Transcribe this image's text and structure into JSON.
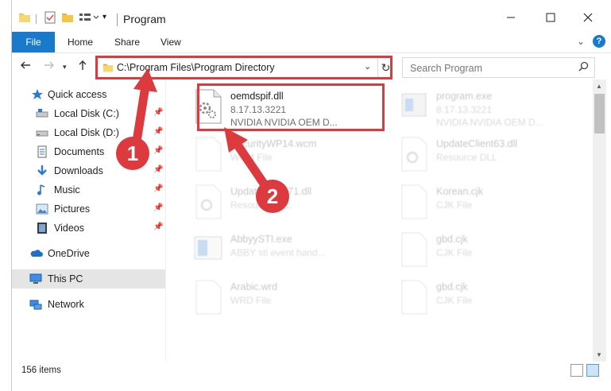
{
  "window": {
    "title": "Program",
    "controls": [
      "minimize",
      "maximize",
      "close"
    ]
  },
  "ribbon": {
    "file_label": "File",
    "tabs": [
      "Home",
      "Share",
      "View"
    ]
  },
  "address": {
    "path": "C:\\Program Files\\Program Directory",
    "search_placeholder": "Search Program"
  },
  "nav": {
    "items": [
      {
        "label": "Quick access",
        "icon": "star-icon",
        "pinned": false
      },
      {
        "label": "Local Disk (C:)",
        "icon": "drive-icon",
        "pinned": true
      },
      {
        "label": "Local Disk (D:)",
        "icon": "drive-icon",
        "pinned": true
      },
      {
        "label": "Documents",
        "icon": "documents-icon",
        "pinned": true
      },
      {
        "label": "Downloads",
        "icon": "download-icon",
        "pinned": true
      },
      {
        "label": "Music",
        "icon": "music-icon",
        "pinned": true
      },
      {
        "label": "Pictures",
        "icon": "pictures-icon",
        "pinned": true
      },
      {
        "label": "Videos",
        "icon": "videos-icon",
        "pinned": true
      },
      {
        "label": "OneDrive",
        "icon": "cloud-icon",
        "pinned": false
      },
      {
        "label": "This PC",
        "icon": "pc-icon",
        "pinned": false,
        "selected": true
      },
      {
        "label": "Network",
        "icon": "network-icon",
        "pinned": false
      }
    ]
  },
  "files": [
    {
      "name": "oemdspif.dll",
      "line2": "8.17.13.3221",
      "line3": "NVIDIA NVIDIA OEM D...",
      "highlighted": true
    },
    {
      "name": "program.exe",
      "line2": "8.17.13.3221",
      "line3": "NVIDIA NVIDIA OEM D...",
      "highlighted": false
    },
    {
      "name": "SecurityWP14.wcm",
      "line2": "WCM File",
      "line3": "",
      "highlighted": false
    },
    {
      "name": "UpdateClient63.dll",
      "line2": "Resource DLL",
      "line3": "",
      "highlighted": false
    },
    {
      "name": "UpdateClient71.dll",
      "line2": "Resource DLL",
      "line3": "",
      "highlighted": false
    },
    {
      "name": "Korean.cjk",
      "line2": "CJK File",
      "line3": "",
      "highlighted": false
    },
    {
      "name": "AbbyySTI.exe",
      "line2": "ABBY sti event hand...",
      "line3": "",
      "highlighted": false
    },
    {
      "name": "gbd.cjk",
      "line2": "CJK File",
      "line3": "",
      "highlighted": false
    },
    {
      "name": "Arabic.wrd",
      "line2": "WRD File",
      "line3": "",
      "highlighted": false
    },
    {
      "name": "gbd.cjk",
      "line2": "CJK File",
      "line3": "",
      "highlighted": false
    }
  ],
  "status": {
    "item_count": "156 items"
  },
  "annotations": {
    "step1": "1",
    "step2": "2",
    "color": "#dc3a3f"
  },
  "colors": {
    "accent": "#1979ca",
    "highlight": "#dc3a3f"
  }
}
